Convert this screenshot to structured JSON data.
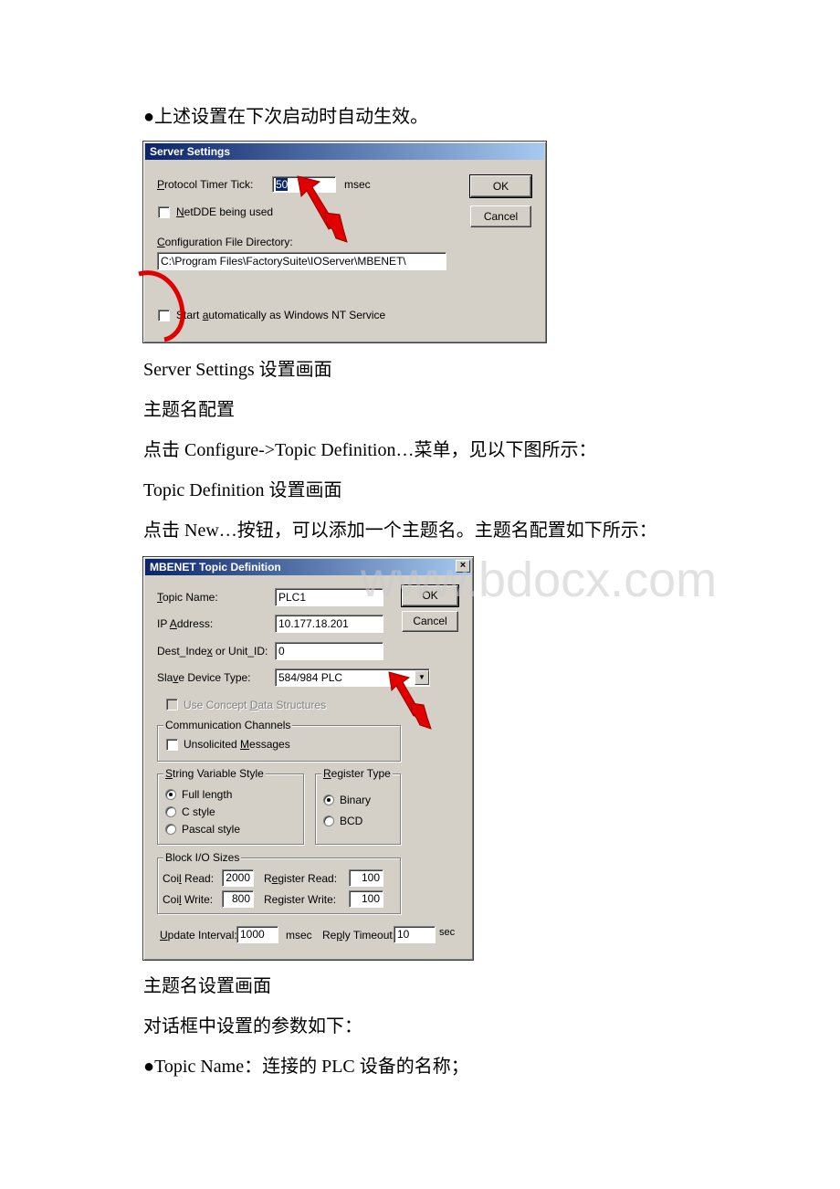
{
  "document": {
    "paragraphs": [
      "●上述设置在下次启动时自动生效。",
      "Server Settings 设置画面",
      "主题名配置",
      "点击 Configure->Topic Definition…菜单，见以下图所示：",
      "Topic Definition 设置画面",
      "点击 New…按钮，可以添加一个主题名。主题名配置如下所示：",
      "主题名设置画面",
      "对话框中设置的参数如下：",
      "●Topic Name：连接的 PLC 设备的名称；"
    ],
    "watermark": "www.bdocx.com"
  },
  "server_settings": {
    "title": "Server Settings",
    "protocol_timer_tick": {
      "label_u": "P",
      "label_rest": "rotocol Timer Tick:",
      "value": "50",
      "unit": "msec"
    },
    "netdde": {
      "label_u": "N",
      "label_rest": "etDDE being used",
      "checked": false
    },
    "config_dir": {
      "label_u": "C",
      "label_rest": "onfiguration File Directory:",
      "value": "C:\\Program Files\\FactorySuite\\IOServer\\MBENET\\"
    },
    "start_service": {
      "label_pre": "Start ",
      "label_u": "a",
      "label_rest": "utomatically as Windows NT Service",
      "checked": false
    },
    "ok_label": "OK",
    "cancel_label": "Cancel",
    "annotation_color": "#e00000"
  },
  "topic_definition": {
    "title": "MBENET Topic Definition",
    "close_icon": "×",
    "topic_name": {
      "label_u": "T",
      "label_rest": "opic Name:",
      "value": "PLC1"
    },
    "ip_address": {
      "label_pre": "IP ",
      "label_u": "A",
      "label_rest": "ddress:",
      "value": "10.177.18.201"
    },
    "dest_index": {
      "label_pre": "Dest_Inde",
      "label_u": "x",
      "label_rest": " or Unit_ID:",
      "value": "0"
    },
    "slave_device": {
      "label_pre": "Sla",
      "label_u": "v",
      "label_rest": "e Device Type:",
      "value": "584/984 PLC"
    },
    "use_concept": {
      "label_pre": "Use Concept ",
      "label_u": "D",
      "label_rest": "ata Structures",
      "checked": false,
      "disabled": true
    },
    "comm_channels": {
      "title": "Communication Channels",
      "unsolicited": {
        "label_pre": "Unsolicited ",
        "label_u": "M",
        "label_rest": "essages",
        "checked": false
      }
    },
    "string_style": {
      "title_u": "S",
      "title_rest": "tring Variable Style",
      "options": [
        "Full length",
        "C style",
        "Pascal style"
      ],
      "selected": "Full length"
    },
    "register_type": {
      "title_u": "R",
      "title_rest": "egister Type",
      "options": [
        "Binary",
        "BCD"
      ],
      "selected": "Binary"
    },
    "block_io": {
      "title": "Block I/O Sizes",
      "coil_read": {
        "label_pre": "Coi",
        "label_u": "l",
        "label_rest": " Read:",
        "value": "2000"
      },
      "coil_write": {
        "label_pre": "Coi",
        "label_u": "l",
        "label_rest": " Write:",
        "value": "800"
      },
      "register_read": {
        "label_pre": "R",
        "label_u": "e",
        "label_rest": "gister Read:",
        "value": "100"
      },
      "register_write": {
        "label_pre": "Register Write:",
        "value": "100"
      }
    },
    "update_interval": {
      "label_u": "U",
      "label_rest": "pdate Interval:",
      "value": "1000",
      "unit": "msec"
    },
    "reply_timeout": {
      "label_pre": "Re",
      "label_u": "p",
      "label_rest": "ly Timeout:",
      "value": "10",
      "unit": "sec"
    },
    "ok_label": "OK",
    "cancel_label": "Cancel"
  }
}
